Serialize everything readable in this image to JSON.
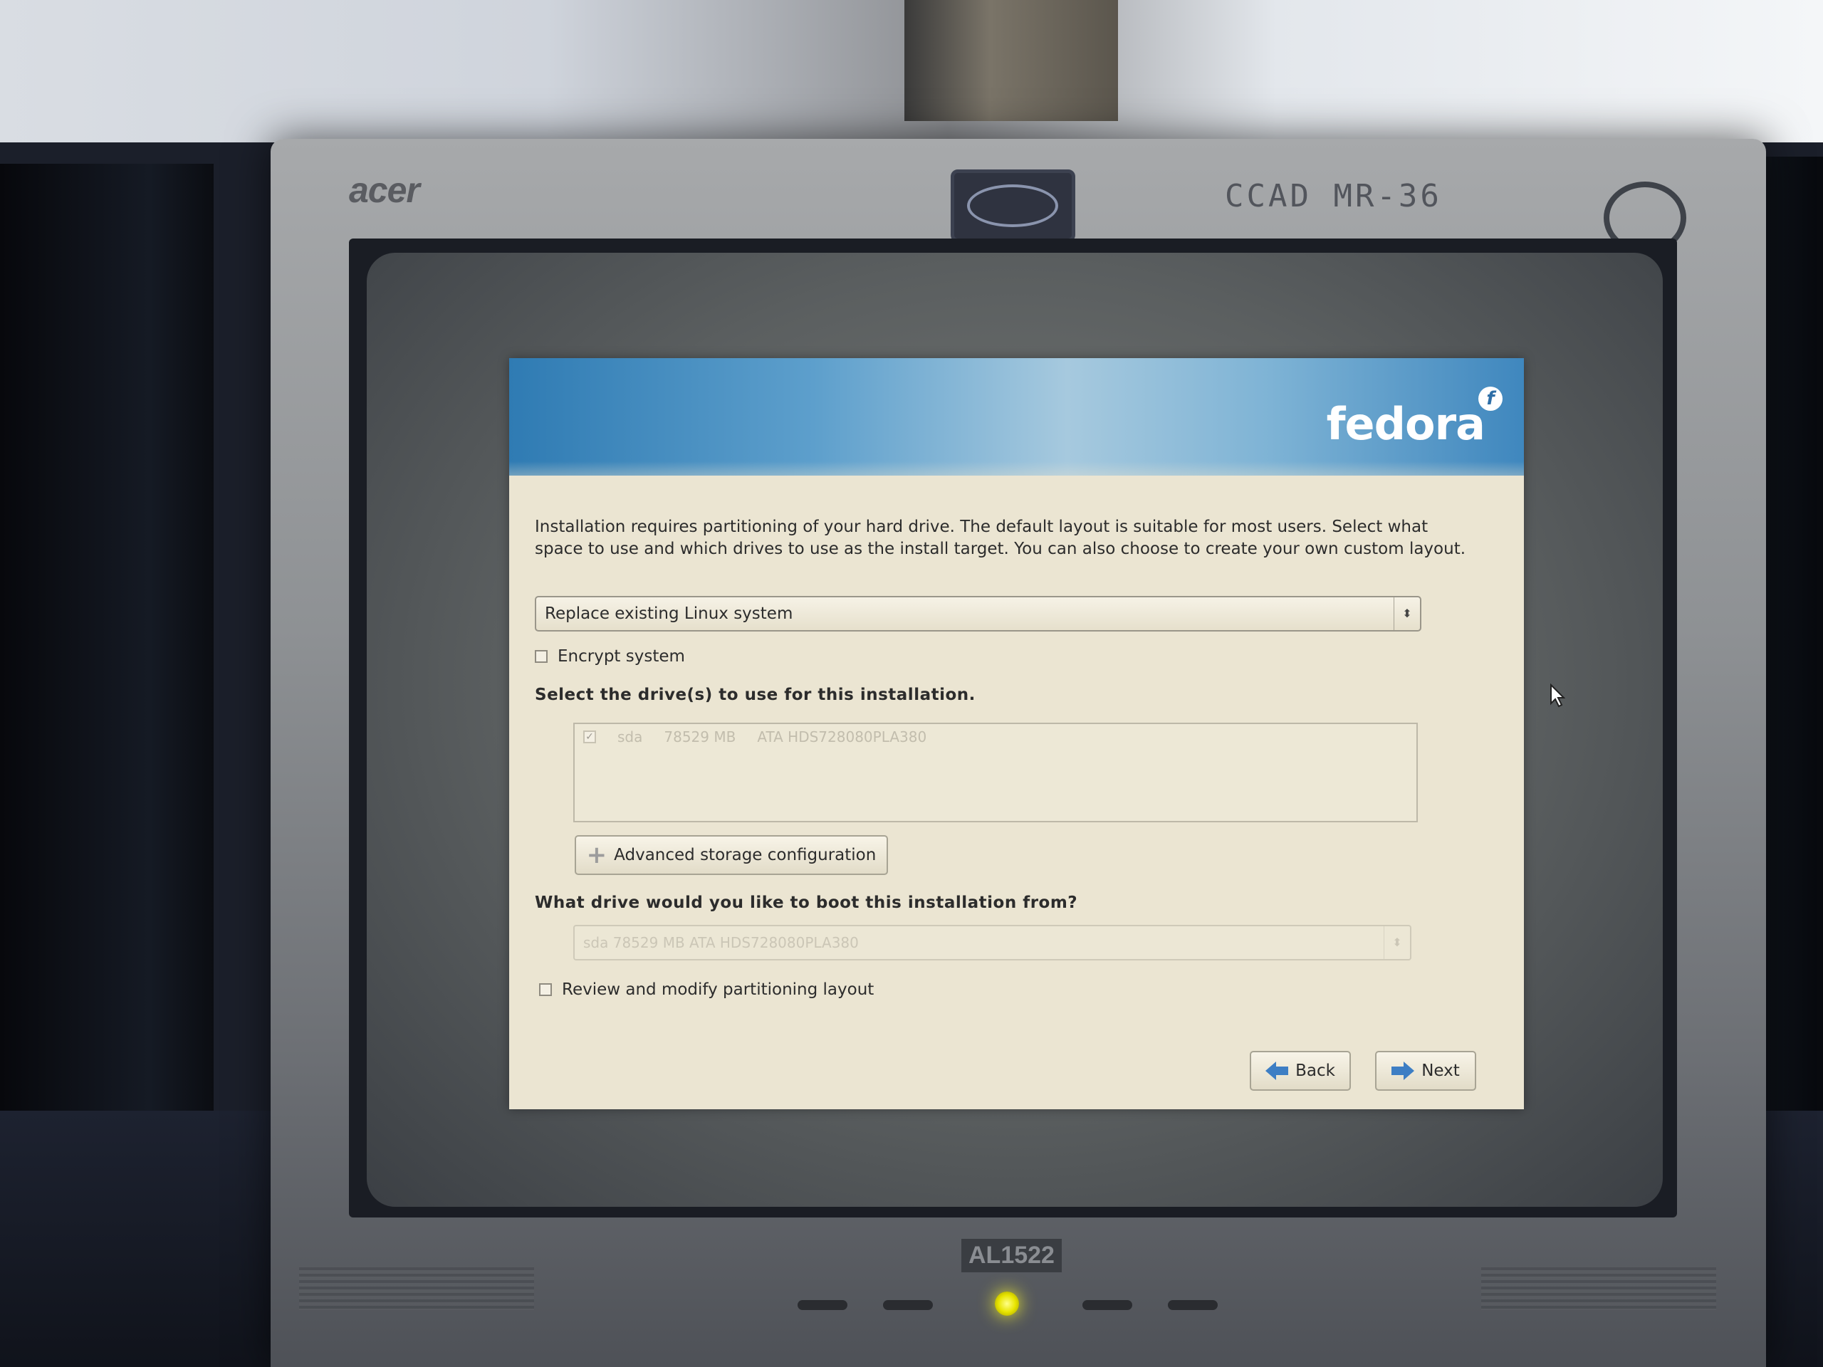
{
  "monitor": {
    "brand": "acer",
    "asset_tag": "CCAD MR-36",
    "model": "AL1522"
  },
  "installer": {
    "logo_text": "fedora",
    "logo_mark": "f",
    "intro": "Installation requires partitioning of your hard drive.  The default layout is suitable for most users.  Select what space to use and which drives to use as the install target. You can also choose to create your own custom layout.",
    "partition_mode": {
      "selected": "Replace existing Linux system",
      "icon": "select-arrows-icon"
    },
    "encrypt": {
      "label": "Encrypt system",
      "checked": false
    },
    "drives_heading": "Select the drive(s) to use for this installation.",
    "drives": [
      {
        "checked": true,
        "name": "sda",
        "size": "78529 MB",
        "model": "ATA HDS728080PLA380"
      }
    ],
    "advanced_button": "Advanced storage configuration",
    "boot_heading": "What drive would you like to boot this installation from?",
    "boot_drive": "sda   78529 MB ATA HDS728080PLA380",
    "review": {
      "label": "Review and modify partitioning layout",
      "checked": false
    },
    "back_button": "Back",
    "next_button": "Next"
  },
  "colors": {
    "banner_blue": "#2f7bb3",
    "panel_background": "#ebe5d2",
    "arrow_blue": "#3d7ec4",
    "power_led": "#e8e400"
  }
}
